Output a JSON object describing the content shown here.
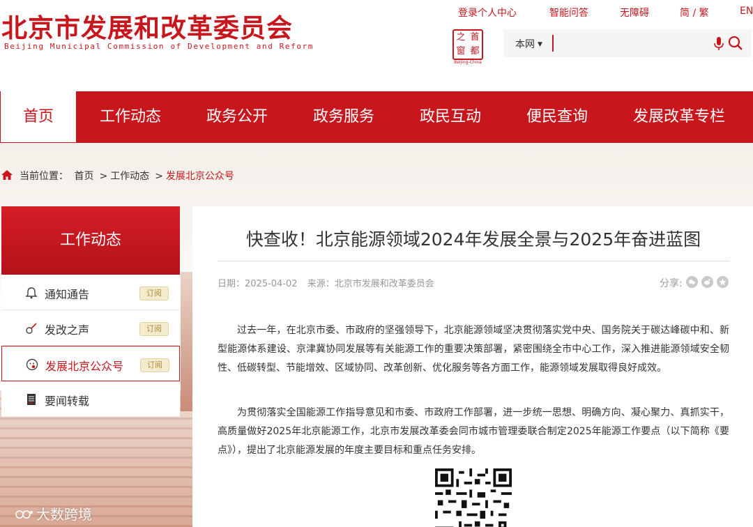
{
  "header": {
    "logo_cn": "北京市发展和改革委员会",
    "logo_en": "Beijing Municipal Commission of Development and Reform",
    "top_links": [
      "登录个人中心",
      "智能问答",
      "无障碍",
      "简 / 繁",
      "EN"
    ],
    "seal": {
      "chars": [
        "之",
        "首",
        "窗",
        "都"
      ],
      "caption": "Beijing-China"
    },
    "search": {
      "scope": "本网",
      "placeholder": ""
    }
  },
  "nav": {
    "items": [
      "首页",
      "工作动态",
      "政务公开",
      "政务服务",
      "政民互动",
      "便民查询",
      "发展改革专栏"
    ],
    "active_index": 0
  },
  "breadcrumb": {
    "prefix": "当前位置：",
    "items": [
      "首页",
      "工作动态",
      "发展北京公众号"
    ]
  },
  "sidebar": {
    "title": "工作动态",
    "items": [
      {
        "label": "通知通告",
        "icon": "bell-icon",
        "subscribe": "订阅"
      },
      {
        "label": "发改之声",
        "icon": "guitar-icon",
        "subscribe": "订阅"
      },
      {
        "label": "发展北京公众号",
        "icon": "wechat-icon",
        "subscribe": "订阅",
        "active": true
      },
      {
        "label": "要闻转载",
        "icon": "newspaper-icon"
      }
    ]
  },
  "article": {
    "title": "快查收！北京能源领域2024年发展全景与2025年奋进蓝图",
    "date": "日期：2025-04-02",
    "source": "来源：北京市发展和改革委员会",
    "share_label": "分享:",
    "share_icons": [
      "wechat-share-icon",
      "weibo-share-icon",
      "qzone-share-icon"
    ],
    "paragraphs": [
      "过去一年，在北京市委、市政府的坚强领导下，北京能源领域坚决贯彻落实党中央、国务院关于碳达峰碳中和、新型能源体系建设、京津冀协同发展等有关能源工作的重要决策部署，紧密围绕全市中心工作，深入推进能源领域安全韧性、低碳转型、节能增效、区域协同、改革创新、优化服务等各方面工作，能源领域发展取得良好成效。",
      "为贯彻落实全国能源工作指导意见和市委、市政府工作部署，进一步统一思想、明确方向、凝心聚力、真抓实干，高质量做好2025年北京能源工作，北京市发展改革委会同市城市管理委联合制定2025年能源工作要点（以下简称《要点》），提出了北京能源发展的年度主要目标和重点任务安排。"
    ]
  },
  "watermark": "大数跨境",
  "colors": {
    "brand_red": "#c8161d",
    "subscribe_bg": "#f4ebcf",
    "text": "#333333",
    "meta": "#999999"
  }
}
